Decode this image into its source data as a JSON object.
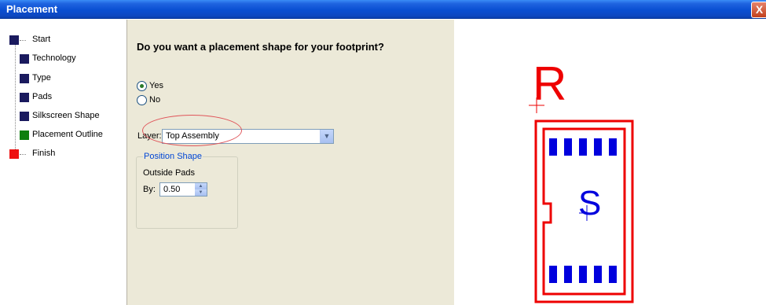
{
  "window": {
    "title": "Placement",
    "close_glyph": "X"
  },
  "steps": [
    {
      "label": "Start",
      "color": "#1a1a5e"
    },
    {
      "label": "Technology",
      "color": "#1a1a5e"
    },
    {
      "label": "Type",
      "color": "#1a1a5e"
    },
    {
      "label": "Pads",
      "color": "#1a1a5e"
    },
    {
      "label": "Silkscreen Shape",
      "color": "#1a1a5e"
    },
    {
      "label": "Placement Outline",
      "color": "#0f7f0f"
    },
    {
      "label": "Finish",
      "color": "#ee1111"
    }
  ],
  "form": {
    "question": "Do you want a placement shape for your footprint?",
    "yes_label": "Yes",
    "no_label": "No",
    "selected": "Yes",
    "layer_label": "Layer:",
    "layer_value": "Top Assembly",
    "group_title": "Position Shape",
    "outside_pads": "Outside Pads",
    "by_label": "By:",
    "by_value": "0.50"
  },
  "preview": {
    "ref_label": "R",
    "value_label": "S",
    "outline_color": "#ee0000",
    "pad_color": "#0000dd",
    "text_color": "#0000dd",
    "top_pad_count": 5,
    "bottom_pad_count": 5
  }
}
